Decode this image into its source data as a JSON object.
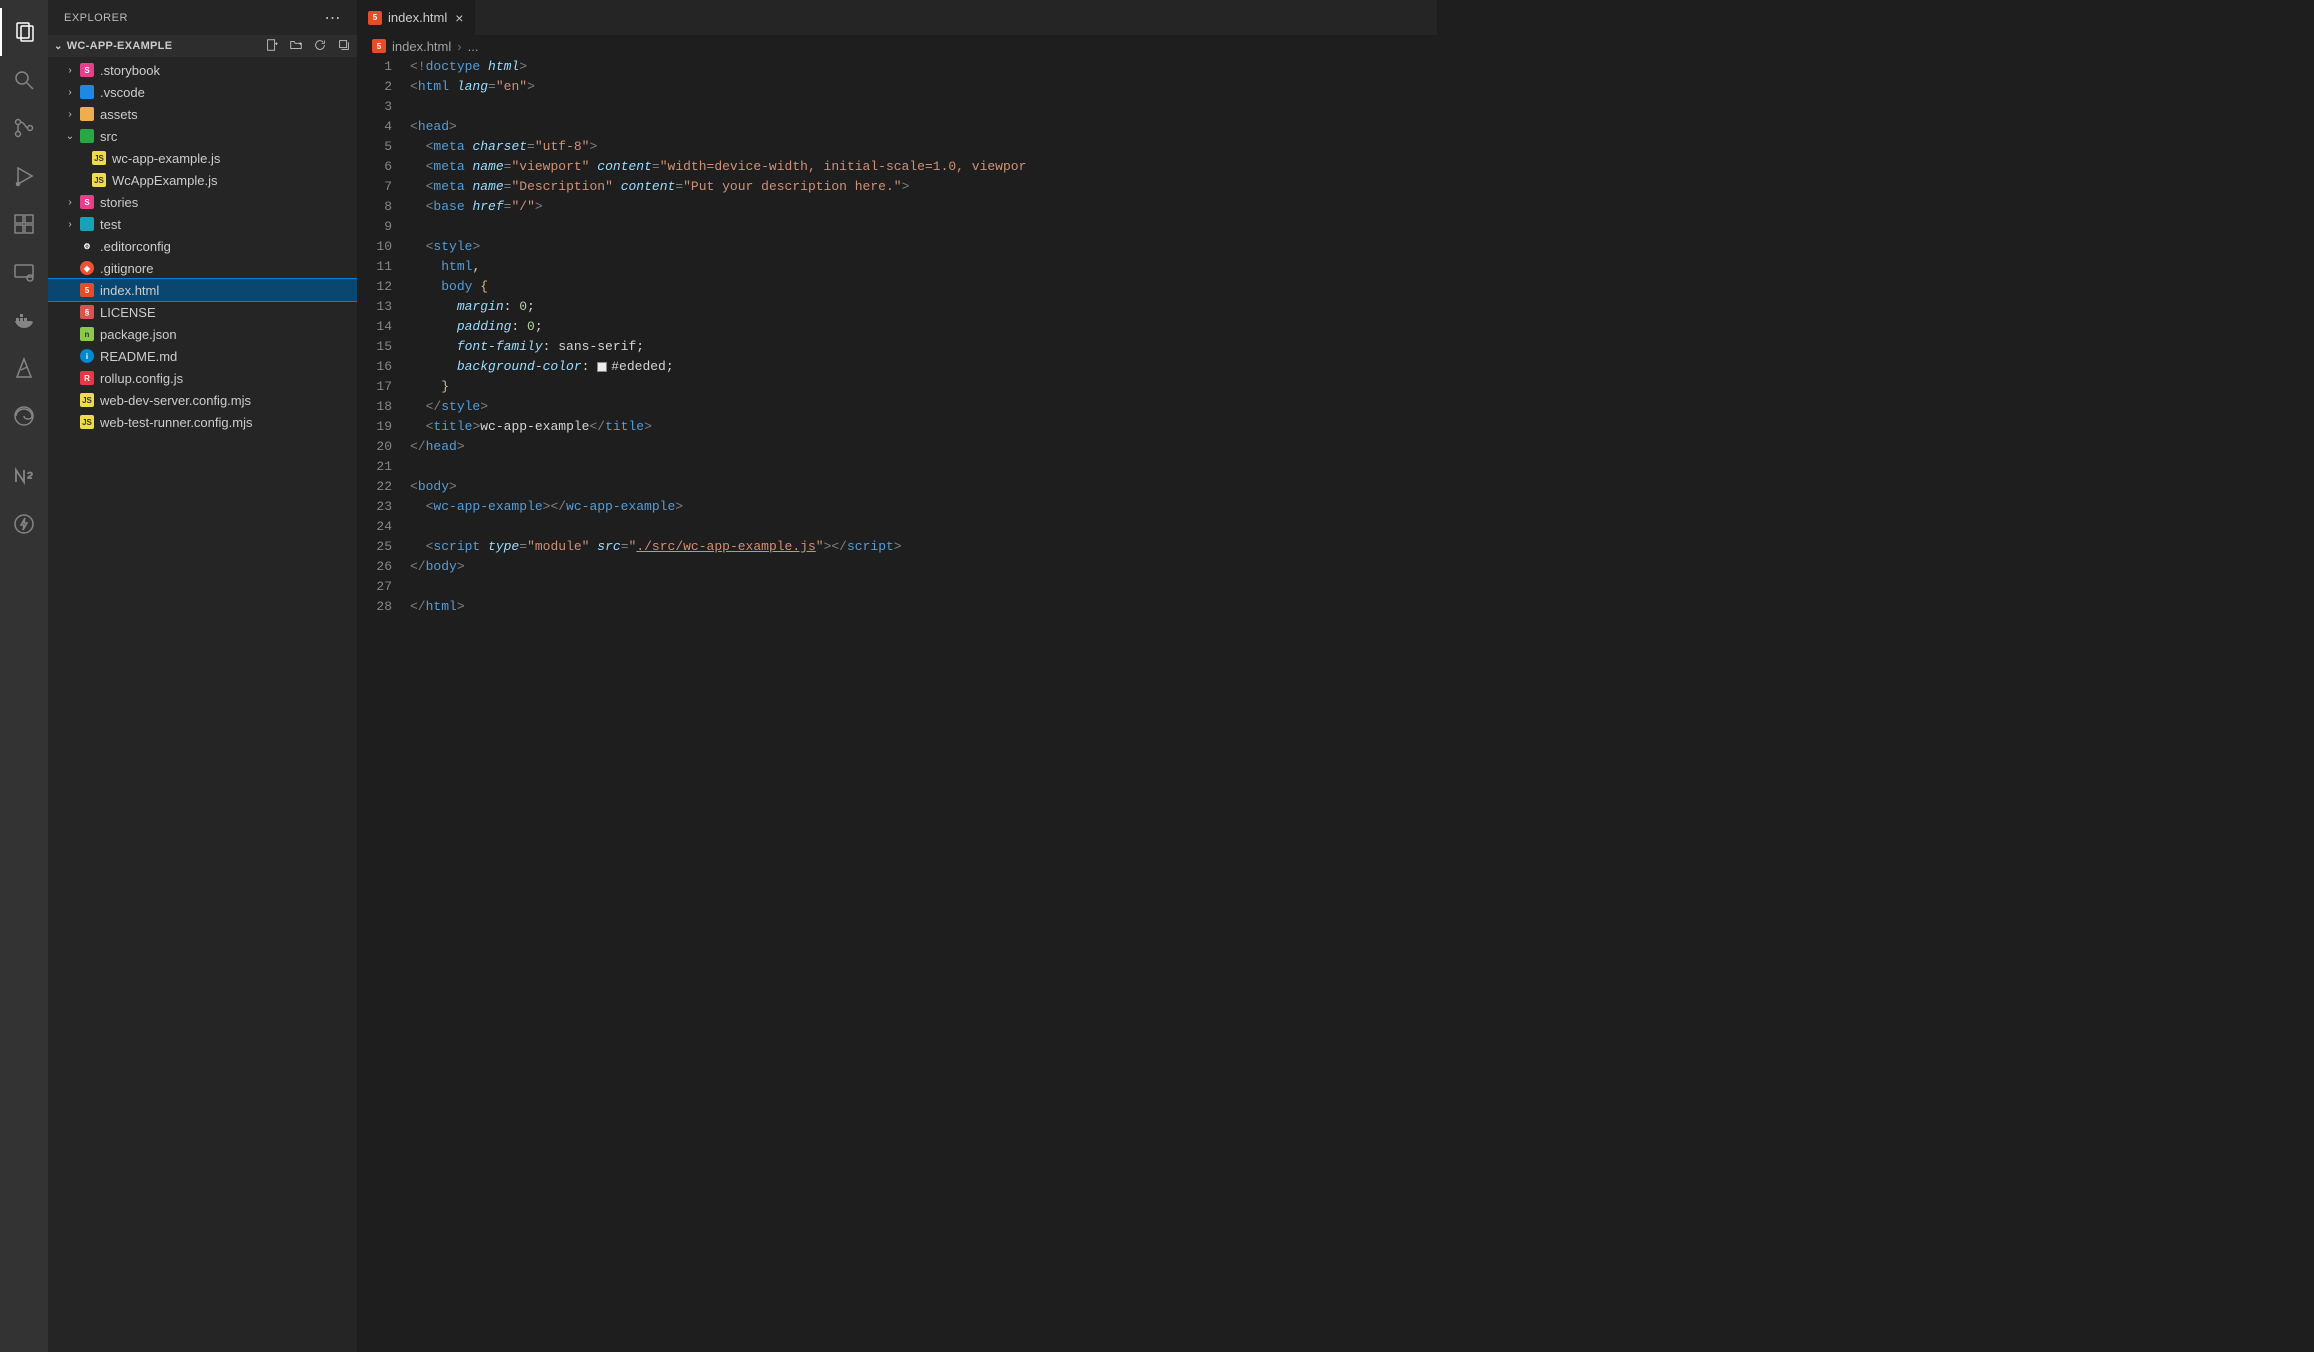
{
  "sidebar": {
    "title": "EXPLORER",
    "project": "WC-APP-EXAMPLE",
    "tree": [
      {
        "kind": "folder",
        "depth": 0,
        "chev": "right",
        "icon": "fi-folder-pink",
        "iconTxt": "S",
        "label": ".storybook"
      },
      {
        "kind": "folder",
        "depth": 0,
        "chev": "right",
        "icon": "fi-folder-blue",
        "iconTxt": "",
        "label": ".vscode"
      },
      {
        "kind": "folder",
        "depth": 0,
        "chev": "right",
        "icon": "fi-folder-yellow",
        "iconTxt": "",
        "label": "assets"
      },
      {
        "kind": "folder",
        "depth": 0,
        "chev": "down",
        "icon": "fi-folder-green",
        "iconTxt": "",
        "label": "src"
      },
      {
        "kind": "file",
        "depth": 1,
        "icon": "fi-js",
        "iconTxt": "JS",
        "label": "wc-app-example.js"
      },
      {
        "kind": "file",
        "depth": 1,
        "icon": "fi-js",
        "iconTxt": "JS",
        "label": "WcAppExample.js"
      },
      {
        "kind": "folder",
        "depth": 0,
        "chev": "right",
        "icon": "fi-folder-pink",
        "iconTxt": "S",
        "label": "stories"
      },
      {
        "kind": "folder",
        "depth": 0,
        "chev": "right",
        "icon": "fi-folder-teal",
        "iconTxt": "",
        "label": "test"
      },
      {
        "kind": "file",
        "depth": 0,
        "icon": "fi-edit",
        "iconTxt": "⚙",
        "label": ".editorconfig"
      },
      {
        "kind": "file",
        "depth": 0,
        "icon": "fi-git",
        "iconTxt": "◆",
        "label": ".gitignore"
      },
      {
        "kind": "file",
        "depth": 0,
        "icon": "fi-html",
        "iconTxt": "5",
        "label": "index.html",
        "selected": true
      },
      {
        "kind": "file",
        "depth": 0,
        "icon": "fi-lic",
        "iconTxt": "§",
        "label": "LICENSE"
      },
      {
        "kind": "file",
        "depth": 0,
        "icon": "fi-pkg",
        "iconTxt": "n",
        "label": "package.json"
      },
      {
        "kind": "file",
        "depth": 0,
        "icon": "fi-md",
        "iconTxt": "i",
        "label": "README.md"
      },
      {
        "kind": "file",
        "depth": 0,
        "icon": "fi-rollup",
        "iconTxt": "R",
        "label": "rollup.config.js"
      },
      {
        "kind": "file",
        "depth": 0,
        "icon": "fi-js",
        "iconTxt": "JS",
        "label": "web-dev-server.config.mjs"
      },
      {
        "kind": "file",
        "depth": 0,
        "icon": "fi-js",
        "iconTxt": "JS",
        "label": "web-test-runner.config.mjs"
      }
    ]
  },
  "editor": {
    "tab": {
      "label": "index.html"
    },
    "breadcrumb": {
      "file": "index.html",
      "rest": "..."
    },
    "modifiedLine": 21,
    "lines": [
      [
        {
          "c": "c-punc",
          "t": "<!"
        },
        {
          "c": "c-tag",
          "t": "doctype "
        },
        {
          "c": "c-attr",
          "t": "html"
        },
        {
          "c": "c-punc",
          "t": ">"
        }
      ],
      [
        {
          "c": "c-punc",
          "t": "<"
        },
        {
          "c": "c-tag",
          "t": "html "
        },
        {
          "c": "c-attr",
          "t": "lang"
        },
        {
          "c": "c-punc",
          "t": "="
        },
        {
          "c": "c-str",
          "t": "\"en\""
        },
        {
          "c": "c-punc",
          "t": ">"
        }
      ],
      [],
      [
        {
          "c": "c-punc",
          "t": "<"
        },
        {
          "c": "c-tag",
          "t": "head"
        },
        {
          "c": "c-punc",
          "t": ">"
        }
      ],
      [
        {
          "c": "c-txt",
          "t": "  "
        },
        {
          "c": "c-punc",
          "t": "<"
        },
        {
          "c": "c-tag",
          "t": "meta "
        },
        {
          "c": "c-attr",
          "t": "charset"
        },
        {
          "c": "c-punc",
          "t": "="
        },
        {
          "c": "c-str",
          "t": "\"utf-8\""
        },
        {
          "c": "c-punc",
          "t": ">"
        }
      ],
      [
        {
          "c": "c-txt",
          "t": "  "
        },
        {
          "c": "c-punc",
          "t": "<"
        },
        {
          "c": "c-tag",
          "t": "meta "
        },
        {
          "c": "c-attr",
          "t": "name"
        },
        {
          "c": "c-punc",
          "t": "="
        },
        {
          "c": "c-str",
          "t": "\"viewport\""
        },
        {
          "c": "c-txt",
          "t": " "
        },
        {
          "c": "c-attr",
          "t": "content"
        },
        {
          "c": "c-punc",
          "t": "="
        },
        {
          "c": "c-str",
          "t": "\"width=device-width, initial-scale=1.0, viewpor"
        }
      ],
      [
        {
          "c": "c-txt",
          "t": "  "
        },
        {
          "c": "c-punc",
          "t": "<"
        },
        {
          "c": "c-tag",
          "t": "meta "
        },
        {
          "c": "c-attr",
          "t": "name"
        },
        {
          "c": "c-punc",
          "t": "="
        },
        {
          "c": "c-str",
          "t": "\"Description\""
        },
        {
          "c": "c-txt",
          "t": " "
        },
        {
          "c": "c-attr",
          "t": "content"
        },
        {
          "c": "c-punc",
          "t": "="
        },
        {
          "c": "c-str",
          "t": "\"Put your description here.\""
        },
        {
          "c": "c-punc",
          "t": ">"
        }
      ],
      [
        {
          "c": "c-txt",
          "t": "  "
        },
        {
          "c": "c-punc",
          "t": "<"
        },
        {
          "c": "c-tag",
          "t": "base "
        },
        {
          "c": "c-attr",
          "t": "href"
        },
        {
          "c": "c-punc",
          "t": "="
        },
        {
          "c": "c-str",
          "t": "\"/\""
        },
        {
          "c": "c-punc",
          "t": ">"
        }
      ],
      [],
      [
        {
          "c": "c-txt",
          "t": "  "
        },
        {
          "c": "c-punc",
          "t": "<"
        },
        {
          "c": "c-tag",
          "t": "style"
        },
        {
          "c": "c-punc",
          "t": ">"
        }
      ],
      [
        {
          "c": "c-txt",
          "t": "    "
        },
        {
          "c": "c-tag",
          "t": "html"
        },
        {
          "c": "c-txt",
          "t": ","
        }
      ],
      [
        {
          "c": "c-txt",
          "t": "    "
        },
        {
          "c": "c-tag",
          "t": "body"
        },
        {
          "c": "c-txt",
          "t": " "
        },
        {
          "c": "c-brace",
          "t": "{"
        }
      ],
      [
        {
          "c": "c-txt",
          "t": "      "
        },
        {
          "c": "c-prop",
          "t": "margin"
        },
        {
          "c": "c-txt",
          "t": ": "
        },
        {
          "c": "c-num",
          "t": "0"
        },
        {
          "c": "c-txt",
          "t": ";"
        }
      ],
      [
        {
          "c": "c-txt",
          "t": "      "
        },
        {
          "c": "c-prop",
          "t": "padding"
        },
        {
          "c": "c-txt",
          "t": ": "
        },
        {
          "c": "c-num",
          "t": "0"
        },
        {
          "c": "c-txt",
          "t": ";"
        }
      ],
      [
        {
          "c": "c-txt",
          "t": "      "
        },
        {
          "c": "c-prop",
          "t": "font-family"
        },
        {
          "c": "c-txt",
          "t": ": sans-serif;"
        }
      ],
      [
        {
          "c": "c-txt",
          "t": "      "
        },
        {
          "c": "c-prop",
          "t": "background-color"
        },
        {
          "c": "c-txt",
          "t": ": "
        },
        {
          "swatch": true
        },
        {
          "c": "c-txt",
          "t": "#ededed;"
        }
      ],
      [
        {
          "c": "c-txt",
          "t": "    "
        },
        {
          "c": "c-brace",
          "t": "}"
        }
      ],
      [
        {
          "c": "c-txt",
          "t": "  "
        },
        {
          "c": "c-punc",
          "t": "</"
        },
        {
          "c": "c-tag",
          "t": "style"
        },
        {
          "c": "c-punc",
          "t": ">"
        }
      ],
      [
        {
          "c": "c-txt",
          "t": "  "
        },
        {
          "c": "c-punc",
          "t": "<"
        },
        {
          "c": "c-tag",
          "t": "title"
        },
        {
          "c": "c-punc",
          "t": ">"
        },
        {
          "c": "c-txt",
          "t": "wc-app-example"
        },
        {
          "c": "c-punc",
          "t": "</"
        },
        {
          "c": "c-tag",
          "t": "title"
        },
        {
          "c": "c-punc",
          "t": ">"
        }
      ],
      [
        {
          "c": "c-punc",
          "t": "</"
        },
        {
          "c": "c-tag",
          "t": "head"
        },
        {
          "c": "c-punc",
          "t": ">"
        }
      ],
      [],
      [
        {
          "c": "c-punc",
          "t": "<"
        },
        {
          "c": "c-tag",
          "t": "body"
        },
        {
          "c": "c-punc",
          "t": ">"
        }
      ],
      [
        {
          "c": "c-txt",
          "t": "  "
        },
        {
          "c": "c-punc",
          "t": "<"
        },
        {
          "c": "c-tag",
          "t": "wc-app-example"
        },
        {
          "c": "c-punc",
          "t": "></"
        },
        {
          "c": "c-tag",
          "t": "wc-app-example"
        },
        {
          "c": "c-punc",
          "t": ">"
        }
      ],
      [],
      [
        {
          "c": "c-txt",
          "t": "  "
        },
        {
          "c": "c-punc",
          "t": "<"
        },
        {
          "c": "c-tag",
          "t": "script "
        },
        {
          "c": "c-attr",
          "t": "type"
        },
        {
          "c": "c-punc",
          "t": "="
        },
        {
          "c": "c-str",
          "t": "\"module\""
        },
        {
          "c": "c-txt",
          "t": " "
        },
        {
          "c": "c-attr",
          "t": "src"
        },
        {
          "c": "c-punc",
          "t": "="
        },
        {
          "c": "c-str",
          "t": "\""
        },
        {
          "c": "c-link",
          "t": "./src/wc-app-example.js"
        },
        {
          "c": "c-str",
          "t": "\""
        },
        {
          "c": "c-punc",
          "t": "></"
        },
        {
          "c": "c-tag",
          "t": "script"
        },
        {
          "c": "c-punc",
          "t": ">"
        }
      ],
      [
        {
          "c": "c-punc",
          "t": "</"
        },
        {
          "c": "c-tag",
          "t": "body"
        },
        {
          "c": "c-punc",
          "t": ">"
        }
      ],
      [],
      [
        {
          "c": "c-punc",
          "t": "</"
        },
        {
          "c": "c-tag",
          "t": "html"
        },
        {
          "c": "c-punc",
          "t": ">"
        }
      ]
    ]
  }
}
